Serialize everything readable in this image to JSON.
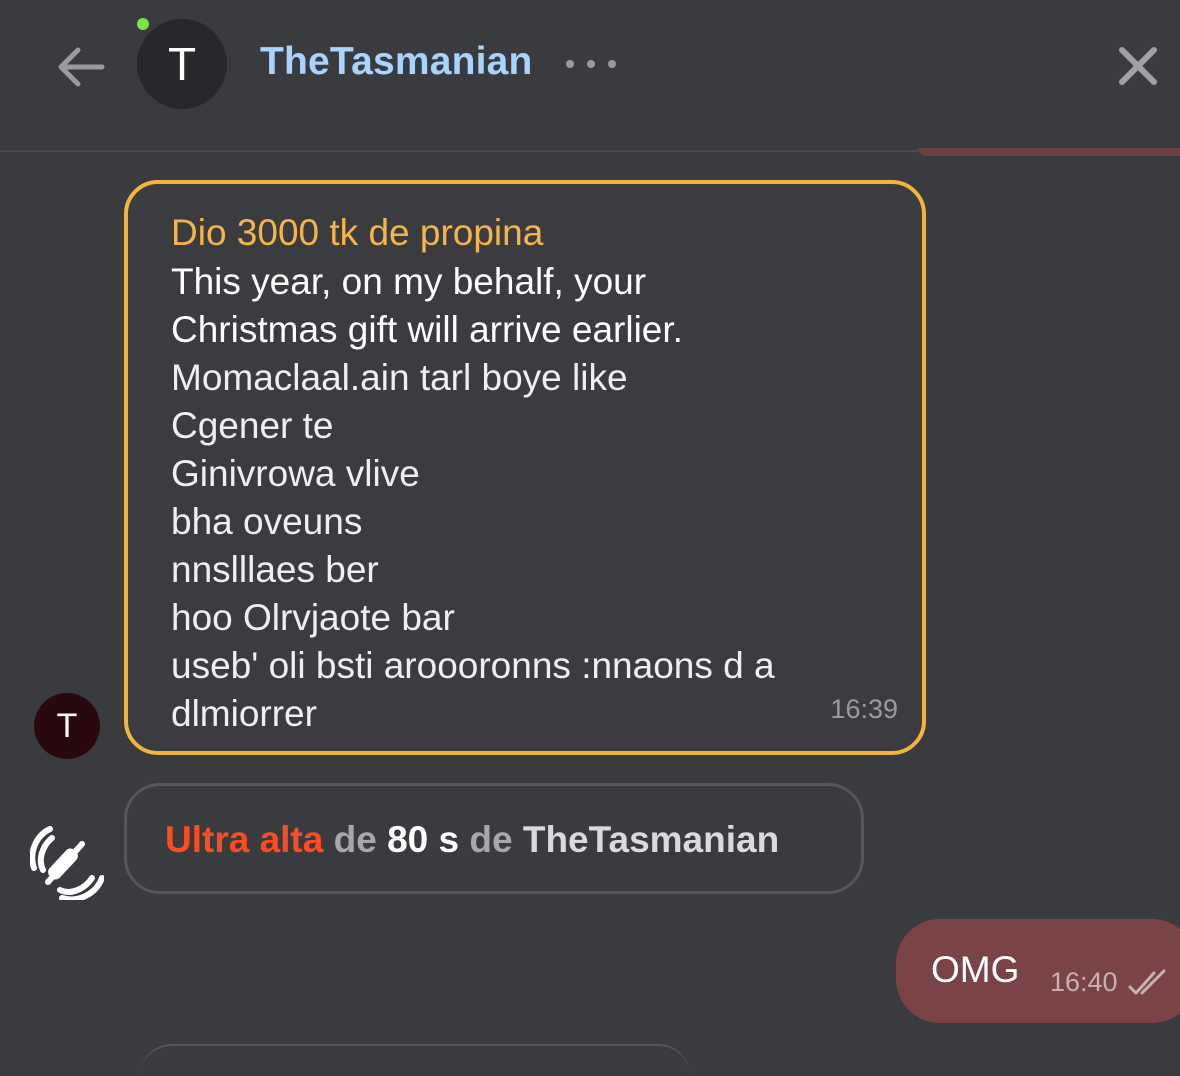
{
  "header": {
    "avatar_initial": "T",
    "contact_name": "TheTasmanian"
  },
  "tip_message": {
    "title": "Dio 3000 tk de propina",
    "lines": [
      "This year, on my behalf, your",
      "Christmas gift will arrive earlier.",
      "Momaclaal.ain tarl boye like",
      "Cgener   te",
      "Ginivrowa vlive",
      "bha oveuns",
      "nnslllaes ber",
      "hoo Olrvjaote bar",
      "useb' oli bsti aroooronns :nnaons d a",
      "dlmiorrer"
    ],
    "time": "16:39",
    "sender_initial": "T"
  },
  "boost_notice": {
    "level": "Ultra alta",
    "de1": "de",
    "duration": "80 s",
    "de2": "de",
    "name": "TheTasmanian"
  },
  "my_message": {
    "text": "OMG",
    "time": "16:40"
  },
  "colors": {
    "background": "#3a3b3f",
    "accent_tip": "#f2b43c",
    "boost_level": "#ff4b1f",
    "contact_name": "#a8d4ff",
    "own_bubble": "#7a4346"
  }
}
